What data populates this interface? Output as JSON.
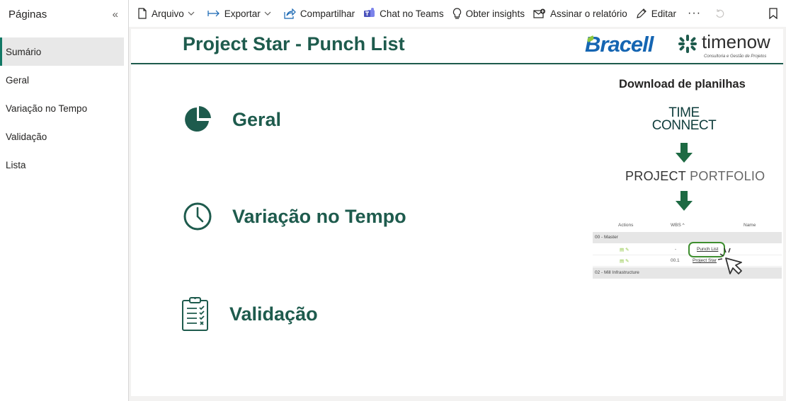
{
  "sidebar": {
    "title": "Páginas",
    "collapse_glyph": "«",
    "items": [
      {
        "label": "Sumário",
        "active": true
      },
      {
        "label": "Geral"
      },
      {
        "label": "Variação no Tempo"
      },
      {
        "label": "Validação"
      },
      {
        "label": "Lista"
      }
    ]
  },
  "toolbar": {
    "arquivo": "Arquivo",
    "exportar": "Exportar",
    "compartilhar": "Compartilhar",
    "chat_teams": "Chat no Teams",
    "obter_insights": "Obter insights",
    "assinar": "Assinar o relatório",
    "editar": "Editar",
    "more": "···"
  },
  "report": {
    "title": "Project Star - Punch List",
    "logo": {
      "bracell": "Bracell",
      "timenow": "timenow",
      "tagline": "Consultoria e Gestão de Projetos"
    },
    "nav": [
      {
        "label": "Geral",
        "icon": "pie-chart-icon"
      },
      {
        "label": "Variação no Tempo",
        "icon": "clock-icon"
      },
      {
        "label": "Validação",
        "icon": "clipboard-checklist-icon"
      }
    ],
    "download": {
      "title": "Download de planilhas",
      "tc_line1": "TIME",
      "tc_line2": "CONNECT",
      "pp_a": "PROJECT",
      "pp_b": "PORTFOLIO",
      "table": {
        "headers": [
          "Actions",
          "WBS ^",
          "Name"
        ],
        "group1": "00 - Master",
        "row1": {
          "wbs": "-",
          "name": "Punch List"
        },
        "row2": {
          "wbs": "00.1",
          "name": "Project Star"
        },
        "group2": "02 - Mill Infrastructure"
      }
    }
  },
  "colors": {
    "accent": "#1e5b4d",
    "brand_blue": "#1565b2",
    "leaf_green": "#8cc63f",
    "arrow": "#1d6a43"
  }
}
